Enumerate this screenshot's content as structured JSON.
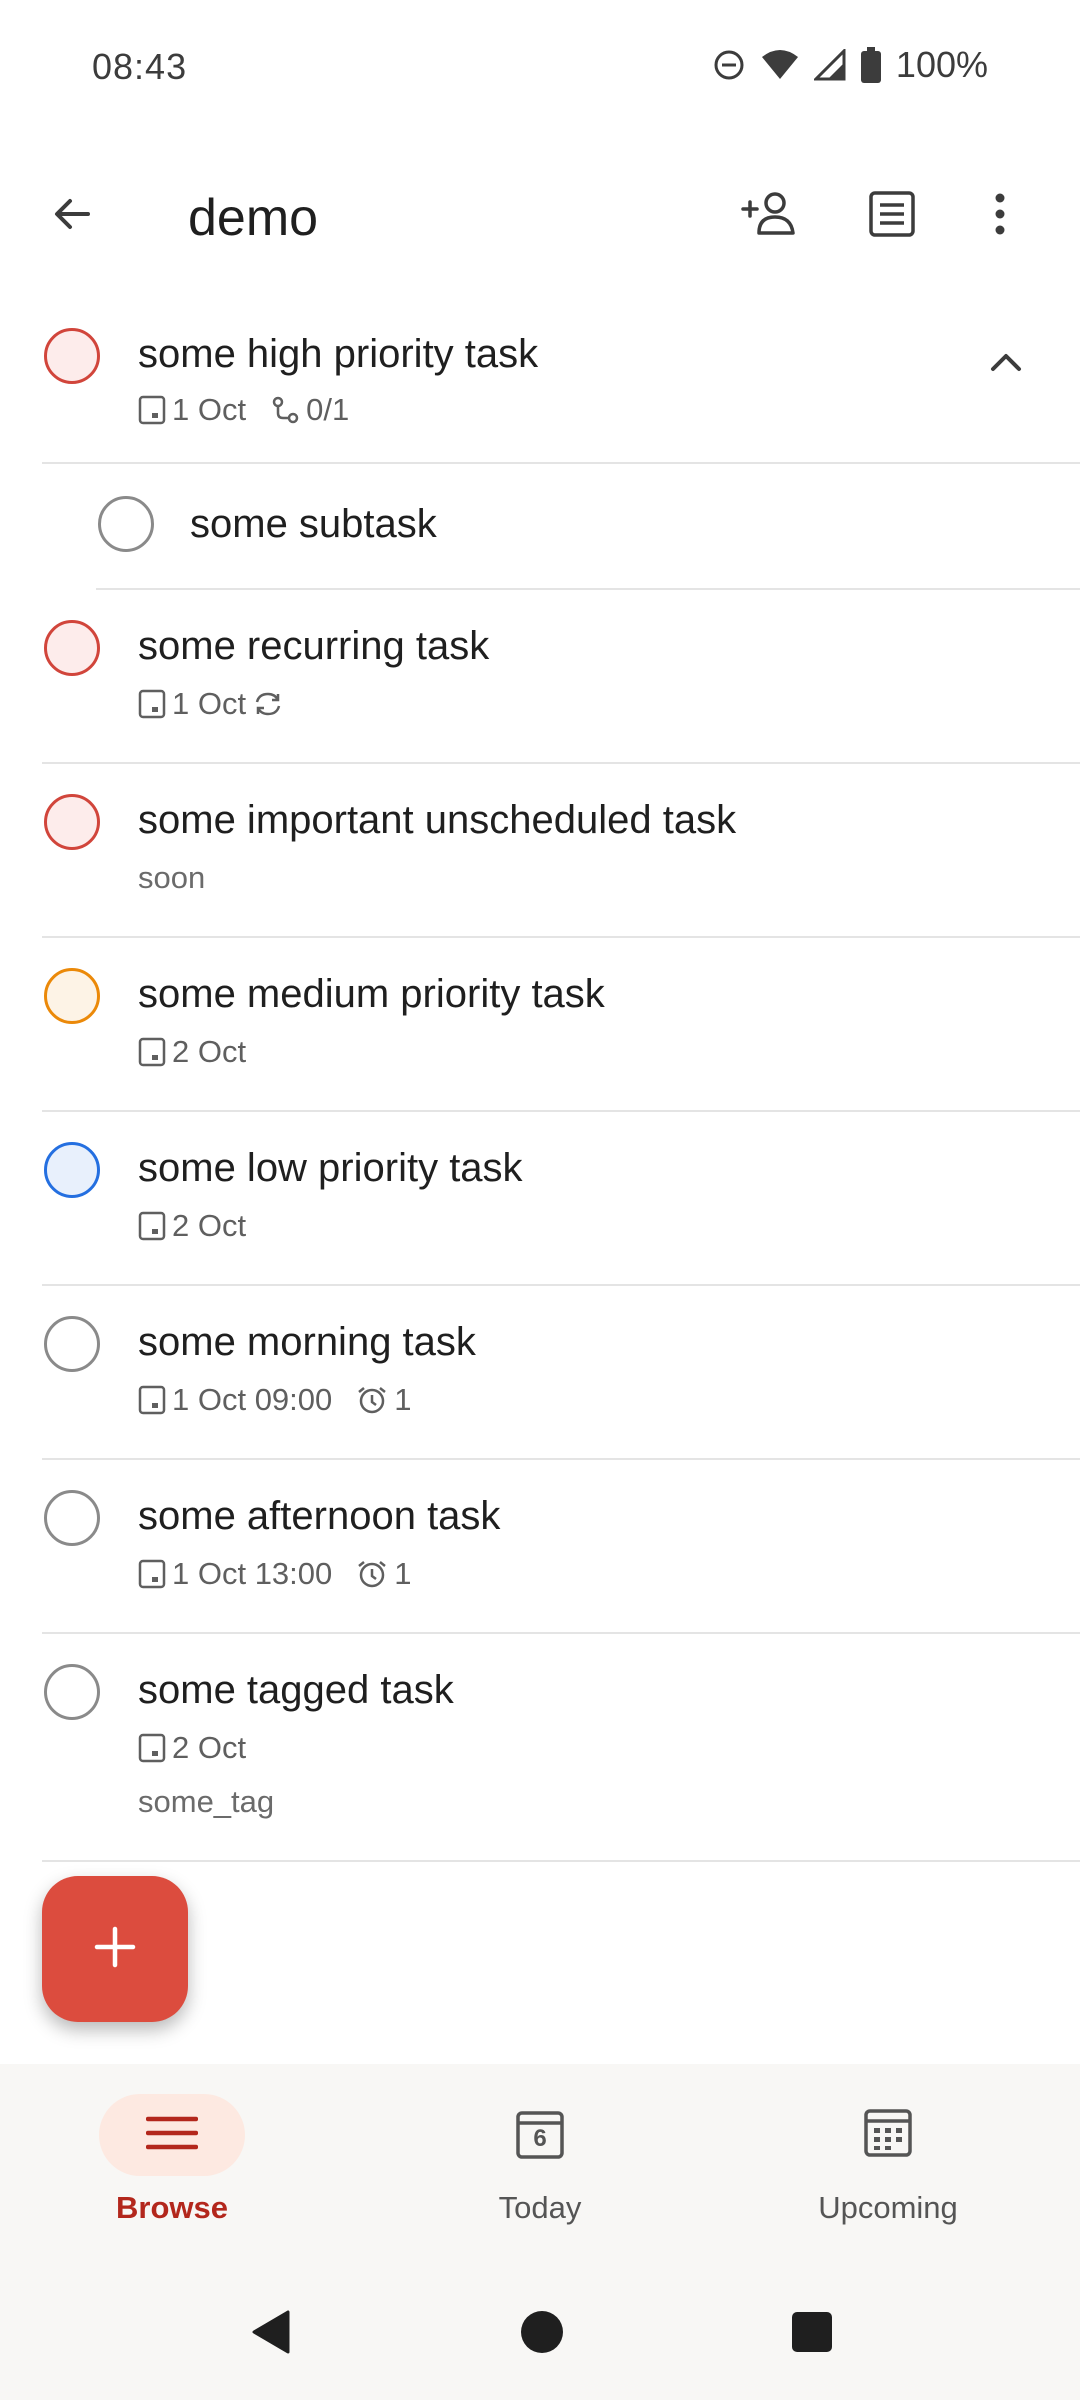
{
  "status_bar": {
    "time": "08:43",
    "battery": "100%",
    "icons": [
      "do-not-disturb-icon",
      "wifi-icon",
      "signal-icon",
      "battery-icon"
    ]
  },
  "app_bar": {
    "title": "demo",
    "icons": [
      "back-arrow-icon",
      "add-person-icon",
      "list-view-icon",
      "more-vert-icon"
    ]
  },
  "tasks": [
    {
      "title": "some high priority task",
      "priority_color": "#d1453b",
      "date": "1 Oct",
      "subtasks": "0/1",
      "expanded": true
    },
    {
      "title": "some subtask",
      "subtask": true
    },
    {
      "title": "some recurring task",
      "priority_color": "#d1453b",
      "date": "1 Oct",
      "recurring": true
    },
    {
      "title": "some important unscheduled task",
      "priority_color": "#d1453b",
      "note": "soon"
    },
    {
      "title": "some medium priority task",
      "priority_color": "#eb8909",
      "date": "2 Oct"
    },
    {
      "title": "some low priority task",
      "priority_color": "#246fe0",
      "date": "2 Oct"
    },
    {
      "title": "some morning task",
      "date": "1 Oct 09:00",
      "reminders": "1"
    },
    {
      "title": "some afternoon task",
      "date": "1 Oct 13:00",
      "reminders": "1"
    },
    {
      "title": "some tagged task",
      "date": "2 Oct",
      "tag": "some_tag"
    }
  ],
  "fab": {
    "icon": "plus-icon"
  },
  "bottom_nav": [
    {
      "label": "Browse",
      "icon": "menu-icon",
      "active": true
    },
    {
      "label": "Today",
      "icon": "calendar-today-icon",
      "day": "6"
    },
    {
      "label": "Upcoming",
      "icon": "calendar-grid-icon"
    }
  ],
  "system_nav": [
    "back-triangle-icon",
    "home-circle-icon",
    "recents-square-icon"
  ],
  "colors": {
    "accent": "#dc4c3e",
    "priority_high": "#d1453b",
    "priority_medium": "#eb8909",
    "priority_low": "#246fe0",
    "nav_active": "#b3271c"
  }
}
